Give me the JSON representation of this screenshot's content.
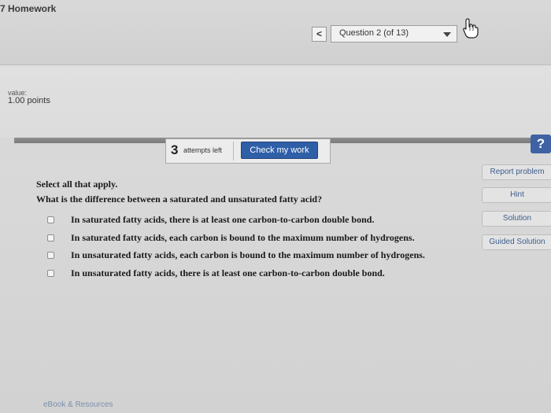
{
  "app": {
    "title": "7 Homework"
  },
  "nav": {
    "prev_symbol": "<",
    "question_select": "Question 2 (of 13)"
  },
  "score": {
    "value_label": "value:",
    "points": "1.00 points"
  },
  "toolbar": {
    "attempts_count": "3",
    "attempts_label": "attempts left",
    "check_label": "Check my work"
  },
  "help": {
    "symbol": "?"
  },
  "sidebar": {
    "report": "Report problem",
    "hint": "Hint",
    "solution": "Solution",
    "guided": "Guided Solution"
  },
  "question": {
    "instruction": "Select all that apply.",
    "text": "What is the difference between a saturated and unsaturated fatty acid?",
    "options": [
      {
        "text": "In saturated fatty acids, there is at least one carbon-to-carbon double bond.",
        "checked": false
      },
      {
        "text": "In saturated fatty acids, each carbon is bound to the maximum number of hydrogens.",
        "checked": false
      },
      {
        "text": "In unsaturated fatty acids, each carbon is bound to the maximum number of hydrogens.",
        "checked": false
      },
      {
        "text": "In unsaturated fatty acids, there is at least one carbon-to-carbon double bond.",
        "checked": false
      }
    ]
  },
  "footer": {
    "ebook": "eBook & Resources"
  },
  "colors": {
    "accent": "#2f5fa6",
    "help": "#3e62a3",
    "link": "#3d5c8e"
  },
  "icons": {
    "cursor": "hand-pointer-icon",
    "select_arrow": "chevron-down-icon",
    "help": "help-icon"
  }
}
